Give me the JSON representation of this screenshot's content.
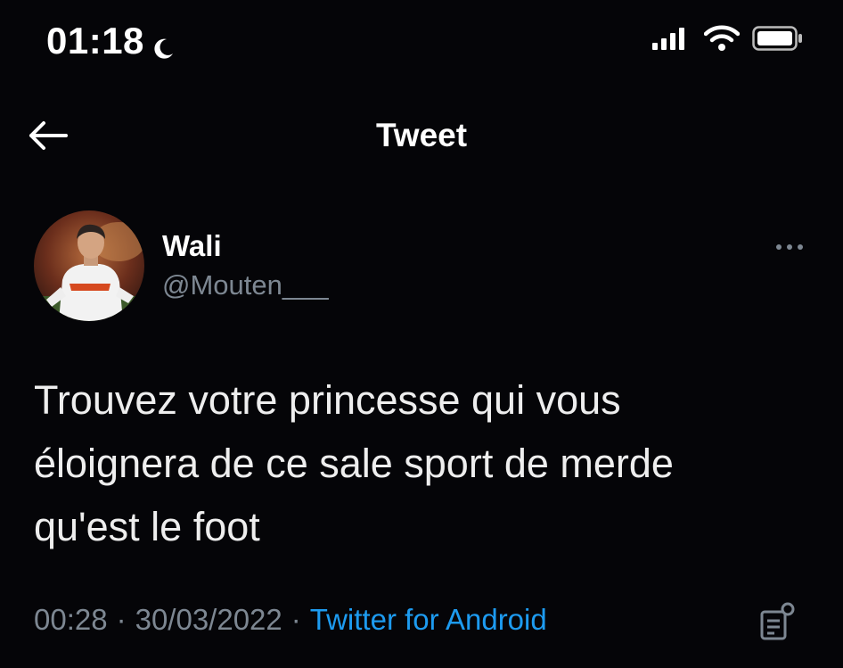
{
  "status_bar": {
    "time": "01:18",
    "icons": [
      "moon-icon",
      "signal-icon",
      "wifi-icon",
      "battery-icon"
    ]
  },
  "nav": {
    "title": "Tweet",
    "back_icon": "arrow-left-icon"
  },
  "tweet": {
    "author": {
      "display_name": "Wali",
      "handle": "@Mouten___"
    },
    "text": "Trouvez votre princesse qui vous\néloignera de ce sale sport de merde\nqu'est le foot",
    "time": "00:28",
    "separator": "·",
    "date": "30/03/2022",
    "source": "Twitter for Android",
    "more_icon": "more-horizontal-icon",
    "analytics_icon": "analytics-icon"
  },
  "colors": {
    "background": "#050508",
    "text_primary": "#ffffff",
    "text_secondary": "#7d8792",
    "link": "#1d9bf0"
  }
}
